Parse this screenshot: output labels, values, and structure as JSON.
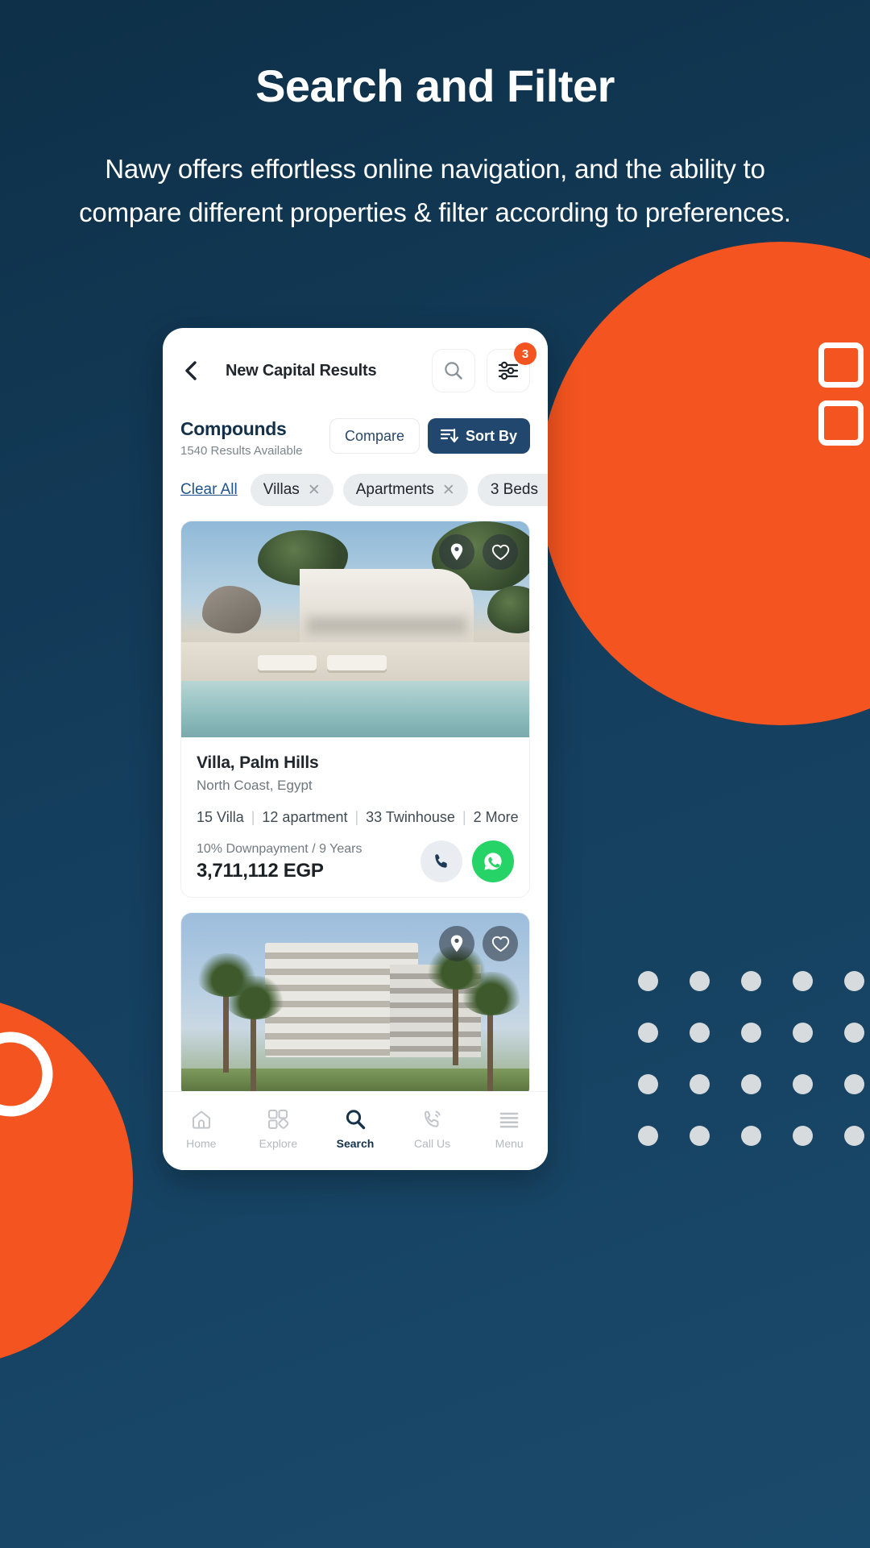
{
  "hero": {
    "title": "Search and Filter",
    "subtitle": "Nawy offers effortless online navigation, and the ability to compare different properties & filter according to preferences."
  },
  "colors": {
    "background": "#133C5B",
    "accent_orange": "#F4541F",
    "navy": "#21476E",
    "link_blue": "#20558C",
    "whatsapp_green": "#25D366"
  },
  "app": {
    "header": {
      "back_icon": "chevron-left-icon",
      "title": "New Capital Results",
      "search_icon": "search-icon",
      "filter_icon": "sliders-icon",
      "filter_badge": "3"
    },
    "compounds": {
      "title": "Compounds",
      "results_text": "1540 Results Available",
      "compare_label": "Compare",
      "sort_label": "Sort By",
      "sort_icon": "sort-descending-icon"
    },
    "filters": {
      "clear_all_label": "Clear All",
      "chips": [
        {
          "label": "Villas",
          "remove_icon": "close-icon"
        },
        {
          "label": "Apartments",
          "remove_icon": "close-icon"
        },
        {
          "label": "3 Beds",
          "remove_icon": "close-icon"
        }
      ]
    },
    "listings": [
      {
        "title": "Villa, Palm Hills",
        "location": "North Coast, Egypt",
        "unit_types": [
          "15 Villa",
          "12 apartment",
          "33 Twinhouse",
          "2 More"
        ],
        "payment_plan": "10% Downpayment / 9 Years",
        "price": "3,711,112 EGP",
        "map_icon": "map-pin-icon",
        "favorite_icon": "heart-icon",
        "call_icon": "phone-icon",
        "whatsapp_icon": "whatsapp-icon"
      },
      {
        "title": "",
        "location": "",
        "unit_types": [],
        "payment_plan": "",
        "price": "",
        "map_icon": "map-pin-icon",
        "favorite_icon": "heart-icon"
      }
    ],
    "bottom_nav": [
      {
        "label": "Home",
        "icon": "home-icon",
        "active": false
      },
      {
        "label": "Explore",
        "icon": "grid-icon",
        "active": false
      },
      {
        "label": "Search",
        "icon": "search-icon",
        "active": true
      },
      {
        "label": "Call Us",
        "icon": "phone-ring-icon",
        "active": false
      },
      {
        "label": "Menu",
        "icon": "hamburger-icon",
        "active": false
      }
    ]
  }
}
